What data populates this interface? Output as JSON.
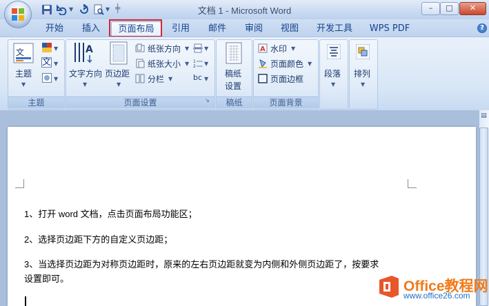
{
  "title_bar": {
    "title": "文档 1 - Microsoft Word",
    "minimize": "–",
    "maximize": "□",
    "close": "✕"
  },
  "tabs": [
    {
      "label": "开始"
    },
    {
      "label": "插入"
    },
    {
      "label": "页面布局"
    },
    {
      "label": "引用"
    },
    {
      "label": "邮件"
    },
    {
      "label": "审阅"
    },
    {
      "label": "视图"
    },
    {
      "label": "开发工具"
    },
    {
      "label": "WPS PDF"
    }
  ],
  "active_tab": "页面布局",
  "help": "?",
  "ribbon": {
    "groups": {
      "theme": "主题",
      "page_setup": "页面设置",
      "draft": "稿纸",
      "page_background": "页面背景"
    },
    "theme_button": "主题",
    "text_direction": "文字方向",
    "margins": "页边距",
    "orientation": "纸张方向",
    "size": "纸张大小",
    "columns": "分栏",
    "draft_settings_line1": "稿纸",
    "draft_settings_line2": "设置",
    "watermark": "水印",
    "page_color": "页面颜色",
    "page_border": "页面边框",
    "paragraph": "段落",
    "arrange": "排列",
    "theme_fonts_glyph": "文",
    "hyphen_glyph": "bc"
  },
  "document": {
    "lines": [
      "1、打开 word 文档，点击页面布局功能区；",
      "2、选择页边距下方的自定义页边距；",
      "3、当选择页边距为对称页边距时，原来的左右页边距就变为内侧和外侧页边距了，按要求",
      "设置即可。"
    ]
  },
  "watermark": {
    "name": "Office教程网",
    "url": "www.office26.com"
  },
  "colors": {
    "highlight": "#d2272f",
    "ribbon_text": "#15428b",
    "watermark_orange": "#f07b1a"
  }
}
